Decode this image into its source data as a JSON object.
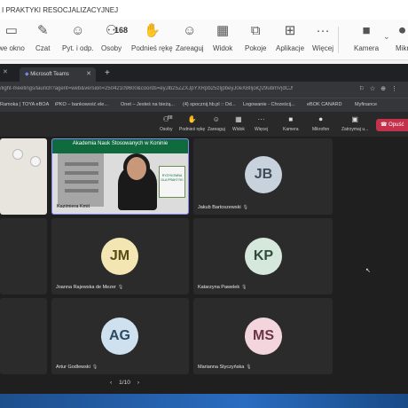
{
  "title_bar": {
    "text": "I PRAKTYKI RESOCJALIZACYJNEJ"
  },
  "outer_toolbar": {
    "items": [
      {
        "id": "new-window",
        "icon": "window",
        "label": "we okno"
      },
      {
        "id": "chat",
        "icon": "chat",
        "label": "Czat"
      },
      {
        "id": "qa",
        "icon": "qa",
        "label": "Pyt. i odp."
      },
      {
        "id": "people",
        "icon": "people",
        "label": "Osoby",
        "count": "168"
      },
      {
        "id": "raise",
        "icon": "hand",
        "label": "Podnieś rękę"
      },
      {
        "id": "react",
        "icon": "smile",
        "label": "Zareaguj"
      },
      {
        "id": "view",
        "icon": "grid",
        "label": "Widok"
      },
      {
        "id": "rooms",
        "icon": "rooms",
        "label": "Pokoje"
      },
      {
        "id": "apps",
        "icon": "plus",
        "label": "Aplikacje"
      },
      {
        "id": "more",
        "icon": "ellipsis",
        "label": "Więcej"
      },
      {
        "id": "camera",
        "icon": "camera",
        "label": "Kamera"
      },
      {
        "id": "mic",
        "icon": "mic",
        "label": "Mikr"
      }
    ]
  },
  "browser": {
    "tab_title": "Microsoft Teams",
    "address": "/light-meetings/launch?agent=web&version=25042109600&coords=eyJlb25ZZXJpYXRpb25zIjpbeyJ0eXBlIjoiQ29ubmVjdCJ9XX0",
    "bookmarks": [
      "Ramoka | TOYA eBOA",
      "iPKO – bankowość ele...",
      "Onet – Jesteś na bieżą...",
      "(4) spocznij.hb.pl :: Od...",
      "Logowanie - Chrześcij...",
      "eBOK CANARD",
      "Myfinance"
    ]
  },
  "meeting_toolbar": {
    "items": [
      {
        "id": "people",
        "label": "Osoby",
        "count": "88"
      },
      {
        "id": "raise",
        "label": "Podnieś rękę"
      },
      {
        "id": "react",
        "label": "Zareaguj"
      },
      {
        "id": "view",
        "label": "Widok"
      },
      {
        "id": "more",
        "label": "Więcej"
      },
      {
        "id": "camera",
        "label": "Kamera"
      },
      {
        "id": "mic",
        "label": "Mikrofon"
      },
      {
        "id": "share",
        "label": "Zatrzymaj u..."
      }
    ],
    "leave_label": "Opuść"
  },
  "tiles": [
    {
      "kind": "video",
      "banner": "Akademia Nauk Stosowanych w Koninie",
      "name": "Kazimiera Kmit",
      "slide_text": "RYZYKOWNA DLA PRAKTYKI"
    },
    {
      "kind": "avatar",
      "initials": "JB",
      "name": "Jakub Bartoszewski",
      "avatar_color": "#c7d2dc",
      "text_color": "#3e4a57"
    },
    {
      "kind": "avatar",
      "initials": "JM",
      "name": "Joanna Rajewska de Mezer",
      "avatar_color": "#f3e6b3",
      "text_color": "#5a4a13"
    },
    {
      "kind": "avatar",
      "initials": "KP",
      "name": "Katarzyna Pawelek",
      "avatar_color": "#d6e8dc",
      "text_color": "#2f4b3a"
    },
    {
      "kind": "avatar",
      "initials": "AG",
      "name": "Artur Godlewski",
      "avatar_color": "#cfe0ef",
      "text_color": "#2d4a63"
    },
    {
      "kind": "avatar",
      "initials": "MS",
      "name": "Marianna Styczyńska",
      "avatar_color": "#f3d6dd",
      "text_color": "#6a3443"
    }
  ],
  "pager": {
    "text": "1/10"
  }
}
